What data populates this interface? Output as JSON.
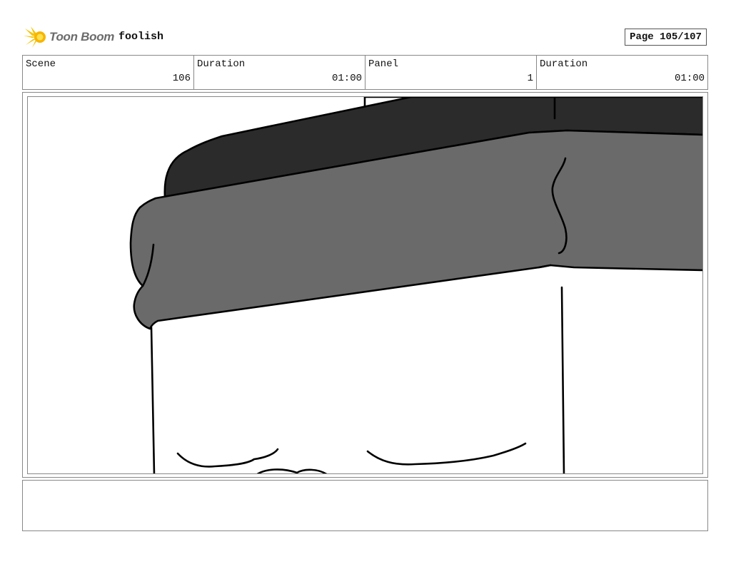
{
  "header": {
    "logo_text": "Toon Boom",
    "project_name": "foolish",
    "page_label": "Page 105/107"
  },
  "info": {
    "scene_label": "Scene",
    "scene_value": "106",
    "scene_duration_label": "Duration",
    "scene_duration_value": "01:00",
    "panel_label": "Panel",
    "panel_value": "1",
    "panel_duration_label": "Duration",
    "panel_duration_value": "01:00"
  },
  "drawing": {
    "dark_fill": "#2b2b2b",
    "mid_fill": "#6a6a6a",
    "line_color": "#000000"
  },
  "notes": {
    "text": ""
  }
}
